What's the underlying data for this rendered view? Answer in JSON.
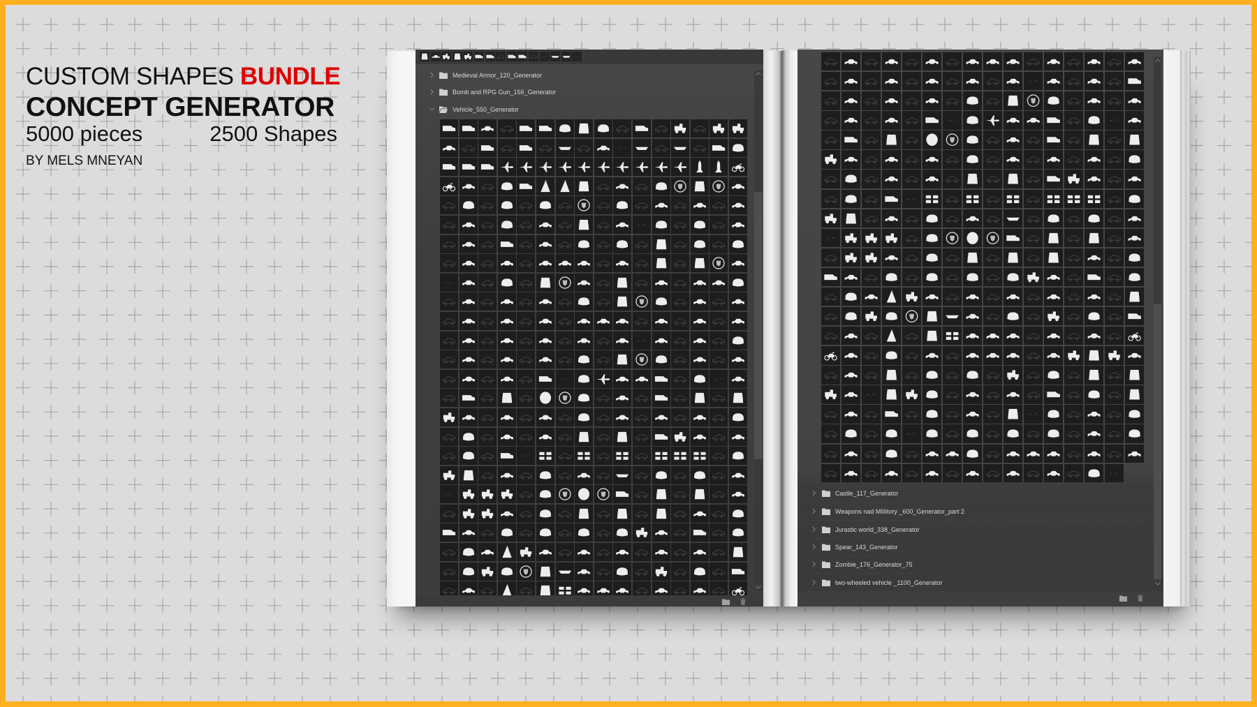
{
  "colors": {
    "frame": "#ffb020",
    "highlight": "#dd0000",
    "background": "#dcdcdc"
  },
  "title": {
    "line1_prefix": "CUSTOM SHAPES",
    "line1_highlight": "BUNDLE",
    "line2": "CONCEPT GENERATOR",
    "pieces": "5000 pieces",
    "shapes": "2500 Shapes",
    "author": "BY MELS MNEYAN"
  },
  "shape_legend": {
    "c": "car-silhouette",
    "f": "car-line-art",
    "b": "car-blob",
    "v": "van-silhouette",
    "w": "vehicle-front",
    "p": "aircraft",
    "r": "rocket",
    "s": "sail",
    "o": "disc",
    "e": "emblem",
    "m": "motorcycle",
    "g": "car-group",
    "k": "boat-hull",
    "t": "machine",
    "x": "faint-sketch"
  },
  "left_panel": {
    "toolbar_shapes": "wctwtvvfvvfxkkx",
    "folders": [
      {
        "label": "Medieval Armor_120_Generator",
        "expanded": false,
        "icon": "folder"
      },
      {
        "label": "Bomb and RPG Gun_156_Generator",
        "expanded": false,
        "icon": "folder"
      },
      {
        "label": "Vehicle_550_Generator",
        "expanded": true,
        "icon": "folder-open"
      }
    ],
    "grid_rows": [
      "vvcfvvbwbfvftftt",
      "cfvfvfkfcxkfkfvb",
      "vvvpppppppppprrm",
      "mcfbvsswfcfbewec",
      "fbfbfbfefbfcfcfc",
      "fcfbfcfwfcxbfbfc",
      "fcfvfcfbfbfwfbfb",
      "fcfcfcccfcfwfwec",
      "xcfbfwecfwfcfccb",
      "fcfcfcfbfwebfcfc",
      "fcfcfcfcccfcfcfc",
      "fcfcfcfcfcxcfcfb",
      "fcfcfcfbfwebfcfc",
      "fcfcfvxbpccvfbxc",
      "fvfwfoebfcfvfwfw",
      "tcfcfcfbfcfcfcfb",
      "fbfcfcfwfwfvtcfc",
      "fbfvxgfgfgfgggfb",
      "twfcfbfcfkfbfbfc",
      "xtttfbeoevfwfwfc",
      "fttcfbfwfwfwfcfb",
      "vcfbfbfbfbtcfvfb",
      "fbcstcfcfcfcfcfw",
      "fbtbewkcfbftfbfv",
      "fcfsfwgcccfcfcfm"
    ],
    "footer_icons": [
      "new-folder",
      "trash"
    ]
  },
  "right_panel": {
    "grid_rows": [
      "fcfcfcfcccfcfcfc",
      "fcfcfcfcfcxcfcfv",
      "fcfcfcfbfwebfcfc",
      "fcfcfvxbpccvfbxc",
      "fvfwfoebfcfvfwfw",
      "tcfcfcfbfcfcfcfb",
      "fbfcfcfwfwfvtcfc",
      "fbfvxgfgfgfgggfb",
      "twfcfbfcfkfbfbfc",
      "xtttfbeoevfwfwfc",
      "fttcfbfwfwfwfcfb",
      "vcfbfbfbfbtcfvfb",
      "fbcstcfcfcfcfcfw",
      "fbtbewkcfbftfbfv",
      "fcfsfwgcccfcfcfm",
      "mcfbfcfcccfctwtc",
      "fcfwfbfbftfbfwfw",
      "tcxwtbfcfcfvfbfw",
      "fcfvfbfcfwxbfcfb",
      "fbfbxbfbfbfbfcfb",
      "fcfbfccbfcccfcfc",
      "fcfcfcfcfcfcfbx"
    ],
    "folders": [
      {
        "label": "Castle_117_Generator",
        "expanded": false,
        "icon": "folder"
      },
      {
        "label": "Weapons nad MIllitory _600_Generator_part 2",
        "expanded": false,
        "icon": "folder"
      },
      {
        "label": "Jurastic world_338_Generator",
        "expanded": false,
        "icon": "folder"
      },
      {
        "label": "Spear_143_Generator",
        "expanded": false,
        "icon": "folder"
      },
      {
        "label": "Zombie_176_Generator_75",
        "expanded": false,
        "icon": "folder"
      },
      {
        "label": "two-wheeled vehicle _1100_Generator",
        "expanded": false,
        "icon": "folder"
      }
    ],
    "footer_icons": [
      "new-folder",
      "trash"
    ]
  }
}
